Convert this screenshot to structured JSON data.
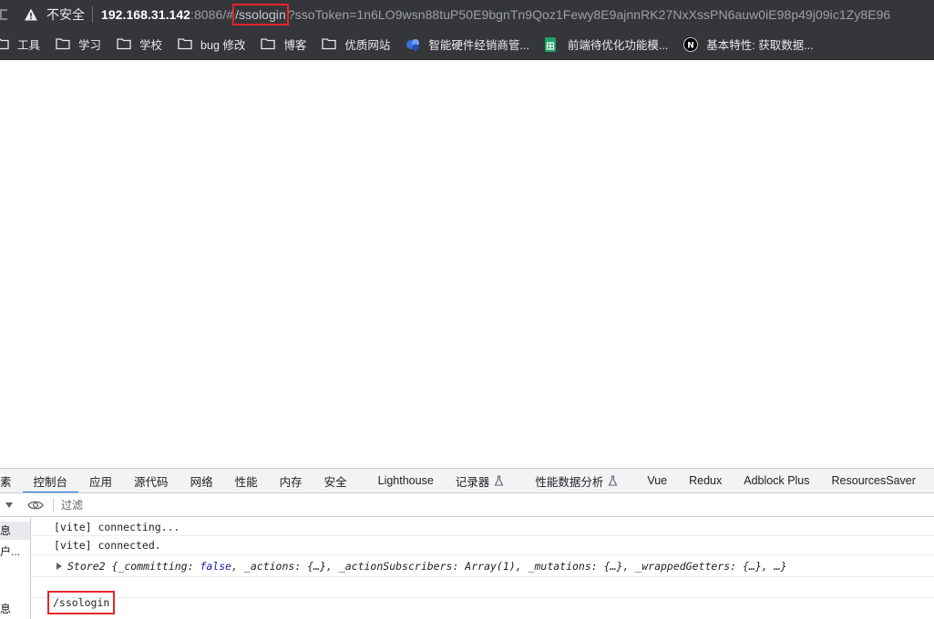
{
  "browser": {
    "security_label": "不安全",
    "url": {
      "host": "192.168.31.142",
      "port_path": ":8086/#",
      "highlighted": "/ssologin",
      "query": "?ssoToken=1n6LO9wsn88tuP50E9bgnTn9Qoz1Fewy8E9ajnnRK27NxXssPN6auw0iE98p49j09ic1Zy8E96"
    }
  },
  "bookmarks": [
    {
      "label": "工具",
      "icon": "folder-icon"
    },
    {
      "label": "学习",
      "icon": "folder-icon"
    },
    {
      "label": "学校",
      "icon": "folder-icon"
    },
    {
      "label": "bug 修改",
      "icon": "folder-icon"
    },
    {
      "label": "博客",
      "icon": "folder-icon"
    },
    {
      "label": "优质网站",
      "icon": "folder-icon"
    },
    {
      "label": "智能硬件经销商管...",
      "icon": "site-favicon"
    },
    {
      "label": "前端待优化功能模...",
      "icon": "sheets-icon"
    },
    {
      "label": "基本特性: 获取数据...",
      "icon": "nextjs-icon"
    }
  ],
  "devtools": {
    "tabs": [
      {
        "label": "素"
      },
      {
        "label": "控制台",
        "active": true
      },
      {
        "label": "应用"
      },
      {
        "label": "源代码"
      },
      {
        "label": "网络"
      },
      {
        "label": "性能"
      },
      {
        "label": "内存"
      },
      {
        "label": "安全"
      },
      {
        "label": "Lighthouse"
      },
      {
        "label": "记录器"
      },
      {
        "label": "性能数据分析"
      },
      {
        "label": "Vue"
      },
      {
        "label": "Redux"
      },
      {
        "label": "Adblock Plus"
      },
      {
        "label": "ResourcesSaver"
      }
    ],
    "filter_placeholder": "过滤",
    "sidebar": [
      "息",
      "户...",
      "息"
    ],
    "console": {
      "line1": "[vite] connecting...",
      "line2": "[vite] connected.",
      "store_name": "Store2",
      "store_parts": [
        {
          "key": "_committing",
          "val": "false",
          "kw": true
        },
        {
          "key": "_actions",
          "val": "{…}"
        },
        {
          "key": "_actionSubscribers",
          "val": "Array(1)"
        },
        {
          "key": "_mutations",
          "val": "{…}"
        },
        {
          "key": "_wrappedGetters",
          "val": "{…}"
        }
      ],
      "store_tail": "…}",
      "highlighted_output": "/ssologin"
    }
  },
  "colors": {
    "chrome_bg": "#35363a",
    "highlight_border": "#e3262c",
    "devtools_active_tab": "#1a73e8"
  }
}
